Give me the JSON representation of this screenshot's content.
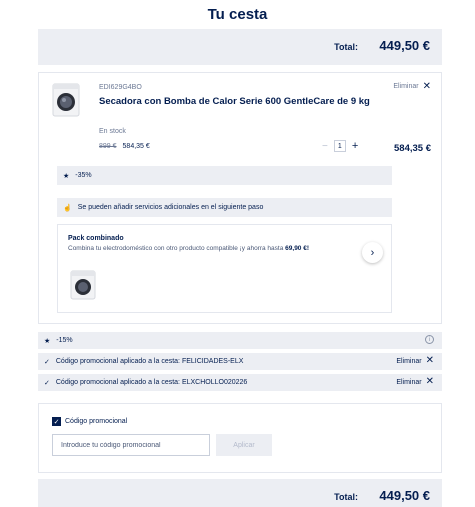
{
  "page": {
    "title": "Tu cesta"
  },
  "summary": {
    "total_label": "Total:",
    "total_value": "449,50 €"
  },
  "product": {
    "code": "EDI629G4BO",
    "remove_label": "Eliminar",
    "name": "Secadora con Bomba de Calor Serie 600 GentleCare de 9 kg",
    "stock": "En stock",
    "old_price": "899 €",
    "new_price": "584,35 €",
    "quantity": "1",
    "line_total": "584,35 €",
    "discount": "-35%",
    "services_note": "Se pueden añadir servicios adicionales en el siguiente paso",
    "pack": {
      "title": "Pack combinado",
      "description": "Combina tu electrodoméstico con otro producto compatible ¡y ahorra hasta",
      "saving": "69,90 €!"
    }
  },
  "cart_discount": "-15%",
  "promos": [
    {
      "text": "Código promocional aplicado a la cesta: FELICIDADES-ELX",
      "remove_label": "Eliminar"
    },
    {
      "text": "Código promocional aplicado a la cesta: ELXCHOLLO020226",
      "remove_label": "Eliminar"
    }
  ],
  "promo_form": {
    "checkbox_label": "Código promocional",
    "input_placeholder": "Introduce tu código promocional",
    "apply_label": "Aplicar"
  },
  "colors": {
    "brand": "#041e50",
    "panel": "#eceef3"
  }
}
